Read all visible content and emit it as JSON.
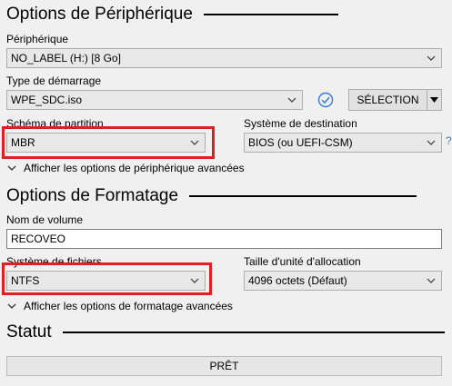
{
  "device_options": {
    "title": "Options de Périphérique",
    "device_label": "Périphérique",
    "device_value": "NO_LABEL (H:) [8 Go]",
    "boot_type_label": "Type de démarrage",
    "boot_type_value": "WPE_SDC.iso",
    "select_button": "SÉLECTION",
    "partition_label": "Schéma de partition",
    "partition_value": "MBR",
    "target_label": "Système de destination",
    "target_value": "BIOS (ou UEFI-CSM)",
    "help_glyph": "?",
    "advanced_toggle": "Afficher les options de périphérique avancées"
  },
  "format_options": {
    "title": "Options de Formatage",
    "volume_label": "Nom de volume",
    "volume_value": "RECOVEO",
    "filesystem_label": "Système de fichiers",
    "filesystem_value": "NTFS",
    "cluster_label": "Taille d'unité d'allocation",
    "cluster_value": "4096 octets (Défaut)",
    "advanced_toggle": "Afficher les options de formatage avancées"
  },
  "status": {
    "title": "Statut",
    "progress_text": "PRÊT",
    "progress_fraction": 0
  },
  "colors": {
    "highlight": "#e02020",
    "check": "#2f7ad8"
  }
}
